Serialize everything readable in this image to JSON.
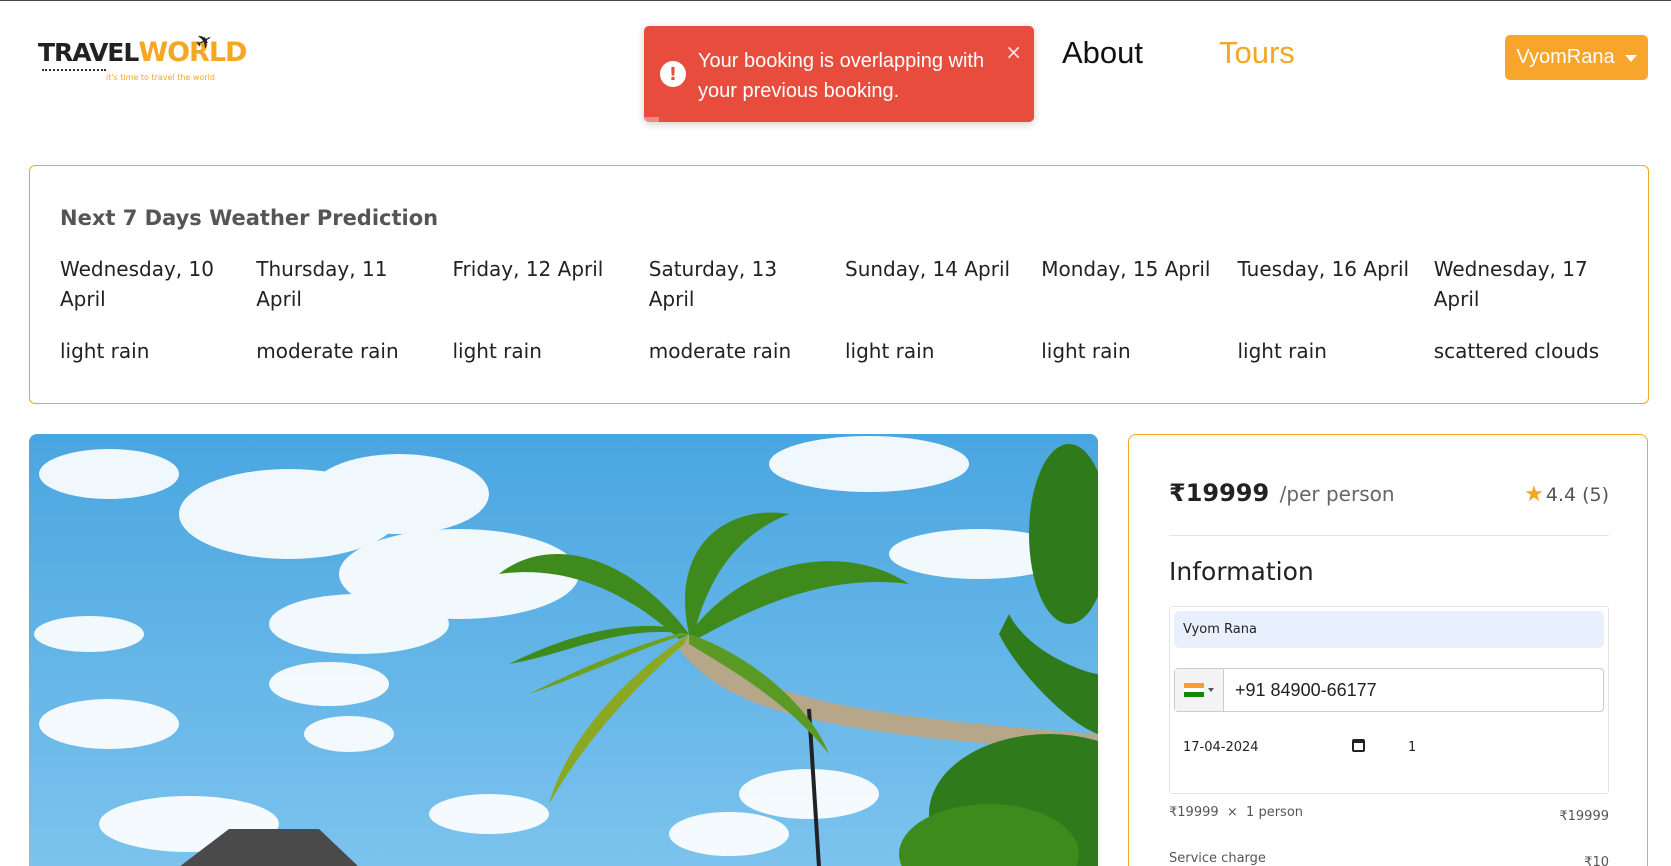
{
  "brand": {
    "logo_left": "TRAVEL",
    "logo_right": "WORLD",
    "tagline": "it's time to travel the world"
  },
  "nav": {
    "about": "About",
    "tours": "Tours"
  },
  "user_menu": {
    "label": "VyomRana"
  },
  "toast": {
    "message": "Your booking is overlapping with your previous booking.",
    "close": "×",
    "icon": "!",
    "type": "error"
  },
  "weather": {
    "title": "Next 7 Days Weather Prediction",
    "days": [
      {
        "date": "Wednesday, 10 April",
        "desc": "light rain"
      },
      {
        "date": "Thursday, 11 April",
        "desc": "moderate rain"
      },
      {
        "date": "Friday, 12 April",
        "desc": "light rain"
      },
      {
        "date": "Saturday, 13 April",
        "desc": "moderate rain"
      },
      {
        "date": "Sunday, 14 April",
        "desc": "light rain"
      },
      {
        "date": "Monday, 15 April",
        "desc": "light rain"
      },
      {
        "date": "Tuesday, 16 April",
        "desc": "light rain"
      },
      {
        "date": "Wednesday, 17 April",
        "desc": "scattered clouds"
      }
    ]
  },
  "booking": {
    "price": "₹19999",
    "per": "/per person",
    "rating": "4.4",
    "reviews": "(5)",
    "info_title": "Information",
    "name_value": "Vyom Rana",
    "phone_value": "+91 84900-66177",
    "date_value": "17-04-2024",
    "guests_value": "1",
    "calc_label": "₹19999  ×  1 person",
    "calc_total": "₹19999",
    "service_label": "Service charge",
    "service_value": "₹10"
  },
  "colors": {
    "accent": "#f5a623",
    "error": "#e74c3c",
    "input_autofill": "#e8f0fe"
  }
}
